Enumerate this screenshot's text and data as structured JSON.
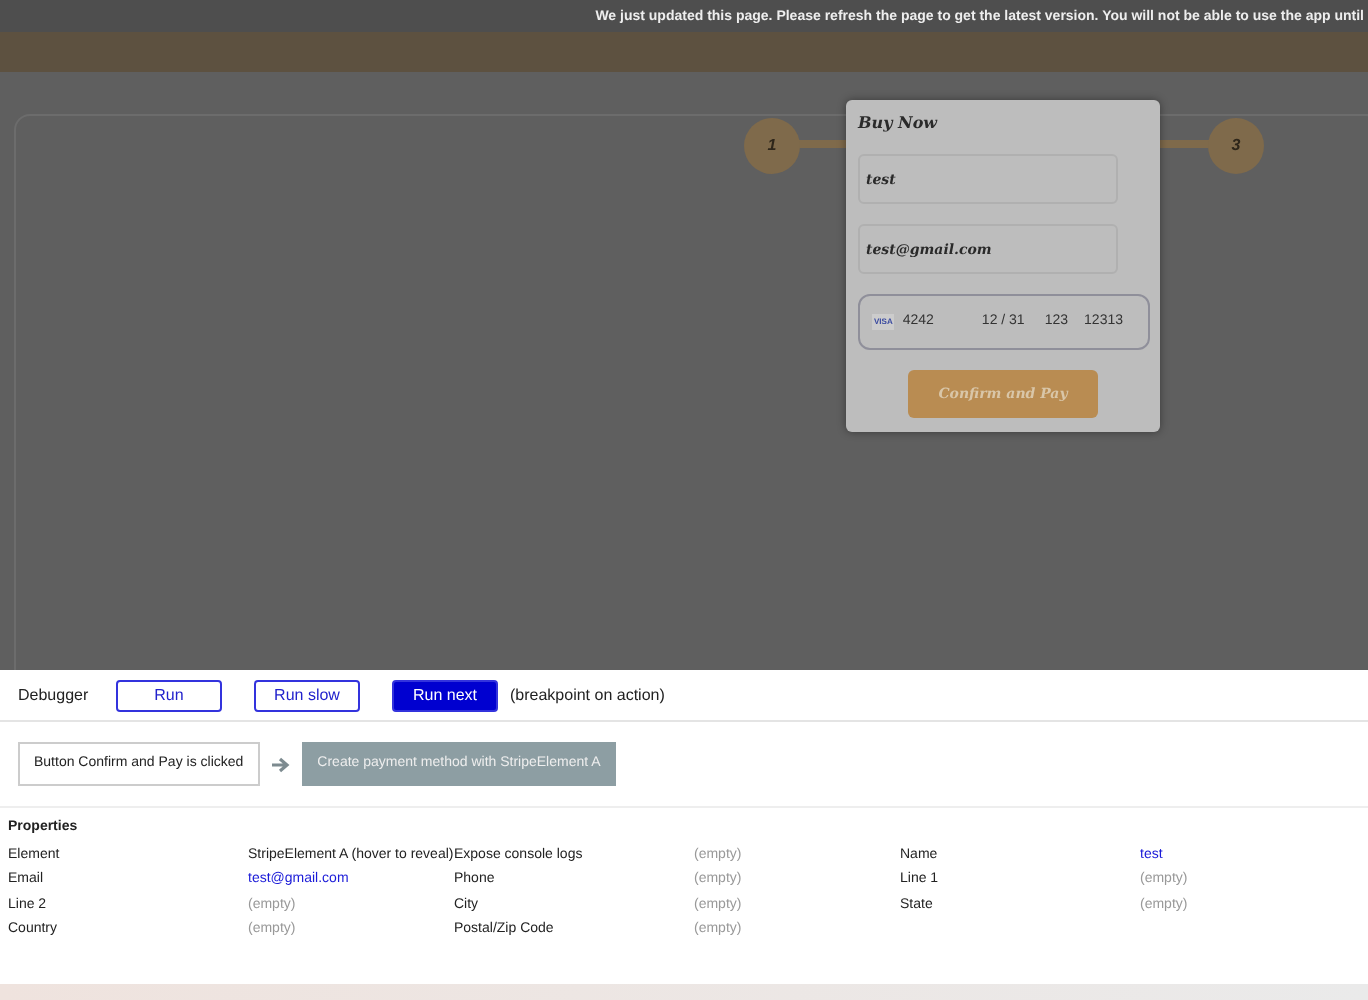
{
  "banner": {
    "text": "We just updated this page. Please refresh the page to get the latest version. You will not be able to use the app until"
  },
  "steps": [
    "1",
    "3"
  ],
  "modal": {
    "title": "Buy Now",
    "fields": [
      {
        "value": "test"
      },
      {
        "value": "test@gmail.com"
      }
    ],
    "card": {
      "brand": "VISA",
      "number": "4242",
      "expiry": "12 / 31",
      "cvc": "123",
      "zip": "12313"
    },
    "button": "Confirm and Pay"
  },
  "debugger": {
    "label": "Debugger",
    "buttons": [
      {
        "label": "Run",
        "selected": false
      },
      {
        "label": "Run slow",
        "selected": false
      },
      {
        "label": "Run next",
        "selected": true
      }
    ],
    "note": "(breakpoint on action)"
  },
  "actions": [
    {
      "label": "Button Confirm and Pay is clicked",
      "current": false
    },
    {
      "label": "Create payment method with StripeElement A",
      "current": true
    }
  ],
  "properties": {
    "title": "Properties",
    "rows": [
      [
        {
          "name": "Element",
          "value": "StripeElement A (hover to reveal)",
          "kind": "text"
        },
        {
          "name": "Expose console logs",
          "value": "(empty)",
          "kind": "empty"
        },
        {
          "name": "Name",
          "value": "test",
          "kind": "link"
        }
      ],
      [
        {
          "name": "Email",
          "value": "test@gmail.com",
          "kind": "link"
        },
        {
          "name": "Phone",
          "value": "(empty)",
          "kind": "empty"
        },
        {
          "name": "Line 1",
          "value": "(empty)",
          "kind": "empty"
        }
      ],
      [
        {
          "name": "Line 2",
          "value": "(empty)",
          "kind": "empty"
        },
        {
          "name": "City",
          "value": "(empty)",
          "kind": "empty"
        },
        {
          "name": "State",
          "value": "(empty)",
          "kind": "empty"
        }
      ],
      [
        {
          "name": "Country",
          "value": "(empty)",
          "kind": "empty"
        },
        {
          "name": "Postal/Zip Code",
          "value": "(empty)",
          "kind": "empty"
        }
      ]
    ]
  }
}
